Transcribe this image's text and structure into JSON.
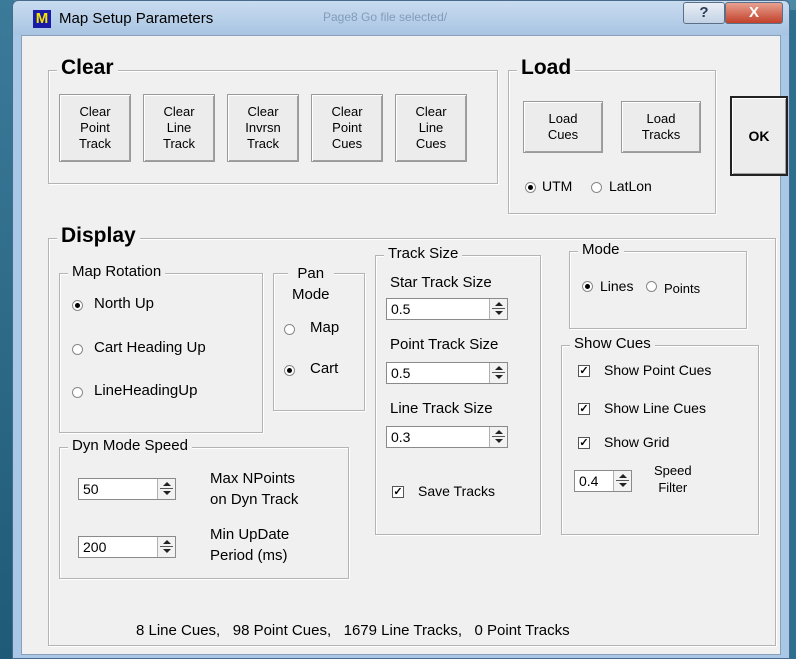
{
  "window": {
    "title": "Map Setup Parameters",
    "ghost_title": "Page8  Go file selected/",
    "icon_letter": "M",
    "help_label": "?",
    "close_label": "X"
  },
  "clear": {
    "title": "Clear",
    "buttons": [
      "Clear\nPoint\nTrack",
      "Clear\nLine\nTrack",
      "Clear\nInvrsn\nTrack",
      "Clear\nPoint\nCues",
      "Clear\nLine\nCues"
    ]
  },
  "load": {
    "title": "Load",
    "load_cues": "Load\nCues",
    "load_tracks": "Load\nTracks",
    "utm": "UTM",
    "latlon": "LatLon",
    "selected": "UTM"
  },
  "ok_label": "OK",
  "display": {
    "title": "Display",
    "map_rotation": {
      "title": "Map Rotation",
      "options": [
        "North Up",
        "Cart Heading Up",
        "LineHeadingUp"
      ],
      "selected": "North Up"
    },
    "pan_mode": {
      "title": "Pan\nMode",
      "options": [
        "Map",
        "Cart"
      ],
      "selected": "Cart"
    },
    "track_size": {
      "title": "Track Size",
      "star_label": "Star Track Size",
      "star_value": "0.5",
      "point_label": "Point Track Size",
      "point_value": "0.5",
      "line_label": "Line Track Size",
      "line_value": "0.3",
      "save_tracks": "Save Tracks",
      "save_checked": true
    },
    "mode": {
      "title": "Mode",
      "options": [
        "Lines",
        "Points"
      ],
      "selected": "Lines"
    },
    "show_cues": {
      "title": "Show Cues",
      "items": [
        "Show Point Cues",
        "Show Line Cues",
        "Show Grid"
      ],
      "checked": [
        true,
        true,
        true
      ],
      "speed_value": "0.4",
      "speed_label": "Speed\nFilter"
    },
    "dyn_mode": {
      "title": "Dyn Mode Speed",
      "max_value": "50",
      "max_label": "Max NPoints\non Dyn Track",
      "min_value": "200",
      "min_label": "Min UpDate\nPeriod (ms)"
    },
    "status": "8 Line Cues,   98 Point Cues,   1679 Line Tracks,   0 Point Tracks"
  },
  "icons": {
    "app": "map-app-icon",
    "help": "help-icon",
    "close": "close-icon"
  }
}
